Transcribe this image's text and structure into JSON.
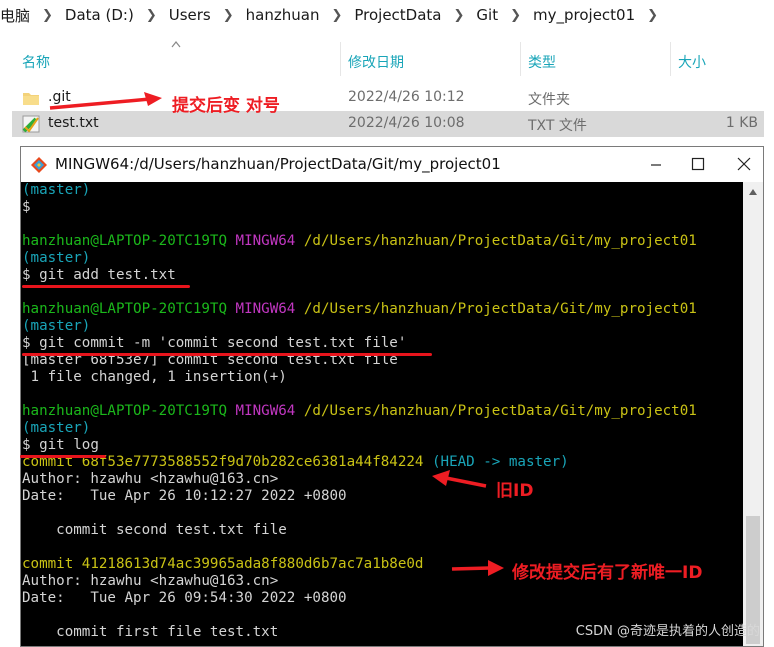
{
  "address_bar": {
    "segments": [
      "电脑",
      "Data (D:)",
      "Users",
      "hanzhuan",
      "ProjectData",
      "Git",
      "my_project01"
    ]
  },
  "columns": {
    "name": "名称",
    "modified": "修改日期",
    "type": "类型",
    "size": "大小"
  },
  "files": [
    {
      "name": ".git",
      "modified": "2022/4/26 10:12",
      "type": "文件夹",
      "size": "",
      "icon": "folder-icon",
      "selected": false
    },
    {
      "name": "test.txt",
      "modified": "2022/4/26 10:08",
      "type": "TXT 文件",
      "size": "1 KB",
      "icon": "git-file-icon",
      "selected": true
    }
  ],
  "terminal": {
    "title": "MINGW64:/d/Users/hanzhuan/ProjectData/Git/my_project01",
    "prompt_user": "hanzhuan@LAPTOP-20TC19TQ",
    "prompt_env": "MINGW64",
    "prompt_path": "/d/Users/hanzhuan/ProjectData/Git/my_project01",
    "branch": "(master)",
    "dollar": "$",
    "cmd_add": "$ git add test.txt",
    "cmd_commit": "$ git commit -m 'commit second test.txt file'",
    "commit_output_1": "[master 68f53e7] commit second test.txt file",
    "commit_output_2": " 1 file changed, 1 insertion(+)",
    "cmd_log": "$ git log",
    "log1_commit": "commit 68f53e7773588552f9d70b282ce6381a44f84224",
    "log1_refs": " (HEAD -> master)",
    "log1_author": "Author: hzawhu <hzawhu@163.cn>",
    "log1_date": "Date:   Tue Apr 26 10:12:27 2022 +0800",
    "log1_msg": "    commit second test.txt file",
    "log2_commit": "commit 41218613d74ac39965ada8f880d6b7ac7a1b8e0d",
    "log2_author": "Author: hzawhu <hzawhu@163.cn>",
    "log2_date": "Date:   Tue Apr 26 09:54:30 2022 +0800",
    "log2_msg": "    commit first file test.txt"
  },
  "annotations": {
    "git_change": "提交后变 对号",
    "old_id": "旧ID",
    "new_id": "修改提交后有了新唯一ID"
  },
  "watermark": "CSDN @奇迹是执着的人创造的",
  "colors": {
    "annotation": "#ee1d23",
    "prompt_green": "#1bb81b",
    "prompt_magenta": "#c237c2",
    "hash_yellow": "#c9c215",
    "branch_cyan": "#19a5b8"
  }
}
